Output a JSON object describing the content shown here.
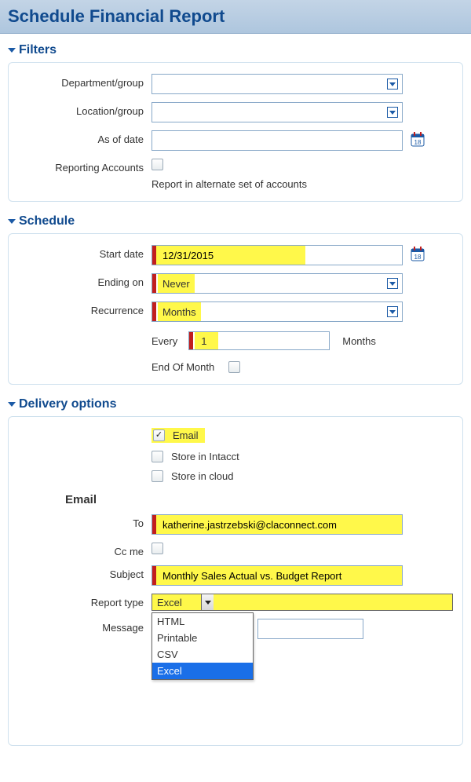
{
  "header": {
    "title": "Schedule Financial Report"
  },
  "filters": {
    "title": "Filters",
    "department_label": "Department/group",
    "department_value": "",
    "location_label": "Location/group",
    "location_value": "",
    "asofdate_label": "As of date",
    "asofdate_value": "",
    "reporting_accounts_label": "Reporting Accounts",
    "reporting_accounts_hint": "Report in alternate set of accounts"
  },
  "schedule": {
    "title": "Schedule",
    "startdate_label": "Start date",
    "startdate_value": "12/31/2015",
    "ending_label": "Ending on",
    "ending_value": "Never",
    "recurrence_label": "Recurrence",
    "recurrence_value": "Months",
    "every_label": "Every",
    "every_value": "1",
    "every_unit": "Months",
    "eom_label": "End Of Month"
  },
  "delivery": {
    "title": "Delivery options",
    "opt_email": "Email",
    "opt_store_intacct": "Store in Intacct",
    "opt_store_cloud": "Store in cloud",
    "email_subhead": "Email",
    "to_label": "To",
    "to_value": "katherine.jastrzebski@claconnect.com",
    "ccme_label": "Cc me",
    "subject_label": "Subject",
    "subject_value": "Monthly Sales Actual vs. Budget Report",
    "reporttype_label": "Report type",
    "reporttype_value": "Excel",
    "reporttype_options": [
      "HTML",
      "Printable",
      "CSV",
      "Excel"
    ],
    "message_label": "Message",
    "message_value": ""
  }
}
